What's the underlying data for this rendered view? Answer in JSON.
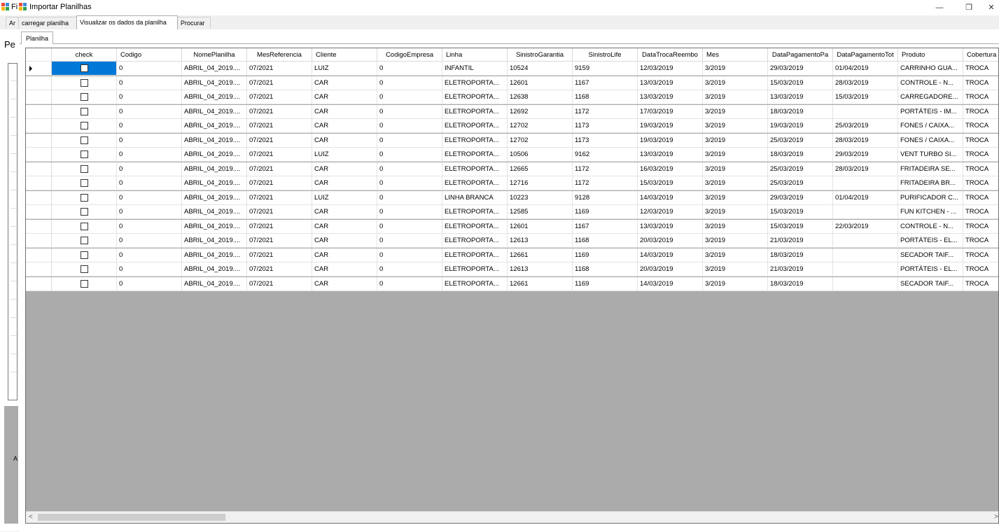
{
  "window": {
    "title_prefix": "Fi",
    "title": "Importar Planilhas",
    "minimize": "—",
    "maximize": "❐",
    "close": "✕"
  },
  "tabs": [
    {
      "label": "Ar"
    },
    {
      "label": "carregar planilha"
    },
    {
      "label": "Visualizar os dados da planilha"
    },
    {
      "label": "Procurar"
    }
  ],
  "background": {
    "label": "Pe",
    "dot_label": "A"
  },
  "inner_tab": {
    "label": "Planilha"
  },
  "grid": {
    "columns": [
      "check",
      "Codigo",
      "NomePlanilha",
      "MesReferencia",
      "Cliente",
      "CodigoEmpresa",
      "Linha",
      "SinistroGarantia",
      "SinistroLife",
      "DataTrocaReembo",
      "Mes",
      "DataPagamentoPa",
      "DataPagamentoTot",
      "Produto",
      "Cobertura"
    ],
    "rows": [
      [
        "",
        "0",
        "ABRIL_04_2019....",
        "07/2021",
        "LUIZ",
        "0",
        "INFANTIL",
        "10524",
        "9159",
        "12/03/2019",
        "3/2019",
        "29/03/2019",
        "01/04/2019",
        "CARRINHO GUA...",
        "TROCA"
      ],
      [
        "",
        "0",
        "ABRIL_04_2019....",
        "07/2021",
        "CAR",
        "0",
        "ELETROPORTA...",
        "12601",
        "1167",
        "13/03/2019",
        "3/2019",
        "15/03/2019",
        "28/03/2019",
        "CONTROLE - N...",
        "TROCA"
      ],
      [
        "",
        "0",
        "ABRIL_04_2019....",
        "07/2021",
        "CAR",
        "0",
        "ELETROPORTA...",
        "12638",
        "1168",
        "13/03/2019",
        "3/2019",
        "13/03/2019",
        "15/03/2019",
        "CARREGADORE...",
        "TROCA"
      ],
      [
        "",
        "0",
        "ABRIL_04_2019....",
        "07/2021",
        "CAR",
        "0",
        "ELETROPORTA...",
        "12692",
        "1172",
        "17/03/2019",
        "3/2019",
        "18/03/2019",
        "",
        "PORTÁTEIS - IM...",
        "TROCA"
      ],
      [
        "",
        "0",
        "ABRIL_04_2019....",
        "07/2021",
        "CAR",
        "0",
        "ELETROPORTA...",
        "12702",
        "1173",
        "19/03/2019",
        "3/2019",
        "19/03/2019",
        "25/03/2019",
        "FONES / CAIXA...",
        "TROCA"
      ],
      [
        "",
        "0",
        "ABRIL_04_2019....",
        "07/2021",
        "CAR",
        "0",
        "ELETROPORTA...",
        "12702",
        "1173",
        "19/03/2019",
        "3/2019",
        "25/03/2019",
        "28/03/2019",
        "FONES / CAIXA...",
        "TROCA"
      ],
      [
        "",
        "0",
        "ABRIL_04_2019....",
        "07/2021",
        "LUIZ",
        "0",
        "ELETROPORTA...",
        "10506",
        "9162",
        "13/03/2019",
        "3/2019",
        "18/03/2019",
        "29/03/2019",
        "VENT TURBO SI...",
        "TROCA"
      ],
      [
        "",
        "0",
        "ABRIL_04_2019....",
        "07/2021",
        "CAR",
        "0",
        "ELETROPORTA...",
        "12665",
        "1172",
        "16/03/2019",
        "3/2019",
        "25/03/2019",
        "28/03/2019",
        "FRITADEIRA SE...",
        "TROCA"
      ],
      [
        "",
        "0",
        "ABRIL_04_2019....",
        "07/2021",
        "CAR",
        "0",
        "ELETROPORTA...",
        "12716",
        "1172",
        "15/03/2019",
        "3/2019",
        "25/03/2019",
        "",
        "FRITADEIRA BR...",
        "TROCA"
      ],
      [
        "",
        "0",
        "ABRIL_04_2019....",
        "07/2021",
        "LUIZ",
        "0",
        "LINHA BRANCA",
        "10223",
        "9128",
        "14/03/2019",
        "3/2019",
        "29/03/2019",
        "01/04/2019",
        "PURIFICADOR C...",
        "TROCA"
      ],
      [
        "",
        "0",
        "ABRIL_04_2019....",
        "07/2021",
        "CAR",
        "0",
        "ELETROPORTA...",
        "12585",
        "1169",
        "12/03/2019",
        "3/2019",
        "15/03/2019",
        "",
        "FUN KITCHEN - ...",
        "TROCA"
      ],
      [
        "",
        "0",
        "ABRIL_04_2019....",
        "07/2021",
        "CAR",
        "0",
        "ELETROPORTA...",
        "12601",
        "1167",
        "13/03/2019",
        "3/2019",
        "15/03/2019",
        "22/03/2019",
        "CONTROLE - N...",
        "TROCA"
      ],
      [
        "",
        "0",
        "ABRIL_04_2019....",
        "07/2021",
        "CAR",
        "0",
        "ELETROPORTA...",
        "12613",
        "1168",
        "20/03/2019",
        "3/2019",
        "21/03/2019",
        "",
        "PORTÁTEIS - EL...",
        "TROCA"
      ],
      [
        "",
        "0",
        "ABRIL_04_2019....",
        "07/2021",
        "CAR",
        "0",
        "ELETROPORTA...",
        "12661",
        "1169",
        "14/03/2019",
        "3/2019",
        "18/03/2019",
        "",
        "SECADOR TAIF...",
        "TROCA"
      ],
      [
        "",
        "0",
        "ABRIL_04_2019....",
        "07/2021",
        "CAR",
        "0",
        "ELETROPORTA...",
        "12613",
        "1168",
        "20/03/2019",
        "3/2019",
        "21/03/2019",
        "",
        "PORTÁTEIS - EL...",
        "TROCA"
      ],
      [
        "",
        "0",
        "ABRIL_04_2019....",
        "07/2021",
        "CAR",
        "0",
        "ELETROPORTA...",
        "12661",
        "1169",
        "14/03/2019",
        "3/2019",
        "18/03/2019",
        "",
        "SECADOR TAIF...",
        "TROCA"
      ]
    ]
  },
  "scroll": {
    "left_arrow": "<",
    "right_arrow": ">"
  },
  "colors": {
    "selection": "#0078d7",
    "empty_area": "#ababab"
  }
}
